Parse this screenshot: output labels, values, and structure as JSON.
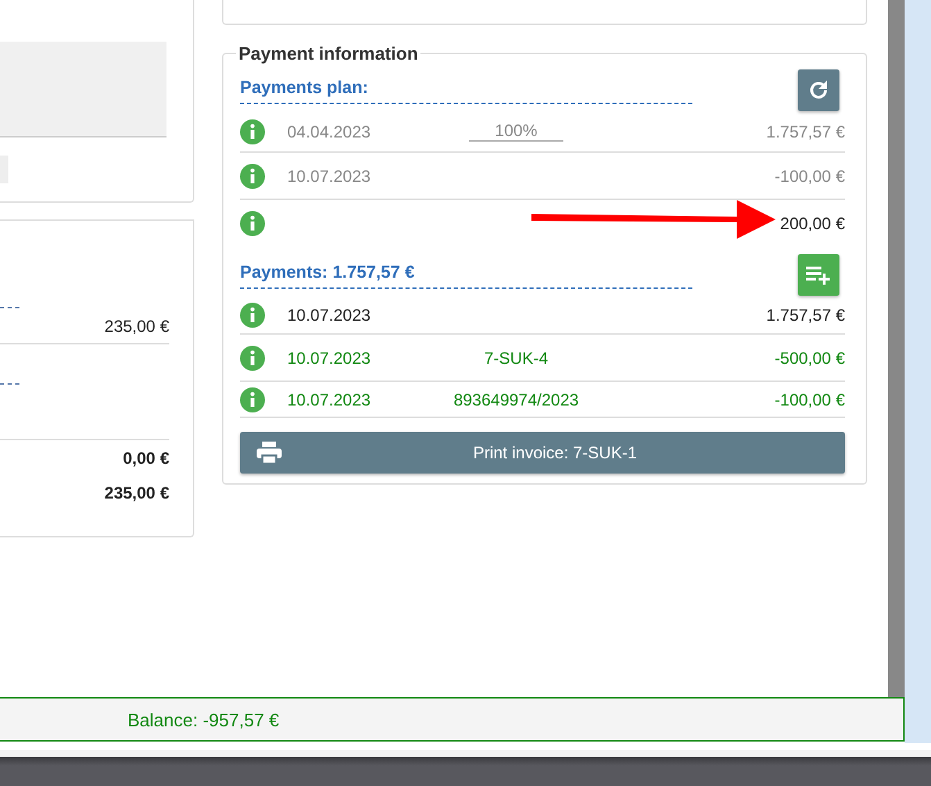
{
  "left_panel": {
    "amount_rows": [
      {
        "value": "235,00 €",
        "bold": false
      },
      {
        "value": "0,00 €",
        "bold": true
      },
      {
        "value": "235,00 €",
        "bold": true
      }
    ]
  },
  "payment_information": {
    "title": "Payment information",
    "plan": {
      "heading": "Payments plan:",
      "rows": [
        {
          "date": "04.04.2023",
          "share": "100%",
          "amount": "1.757,57 €",
          "kind": "muted"
        },
        {
          "date": "10.07.2023",
          "amount": "-100,00 €",
          "kind": "muted"
        },
        {
          "amount": "200,00 €",
          "kind": "normal"
        }
      ]
    },
    "payments": {
      "heading": "Payments: 1.757,57 €",
      "rows": [
        {
          "date": "10.07.2023",
          "amount": "1.757,57 €",
          "kind": "normal"
        },
        {
          "date": "10.07.2023",
          "reference": "7-SUK-4",
          "amount": "-500,00 €",
          "kind": "paid"
        },
        {
          "date": "10.07.2023",
          "reference": "893649974/2023",
          "amount": "-100,00 €",
          "kind": "paid"
        }
      ]
    },
    "print_button": "Print invoice: 7-SUK-1"
  },
  "balance": "Balance: -957,57 €"
}
